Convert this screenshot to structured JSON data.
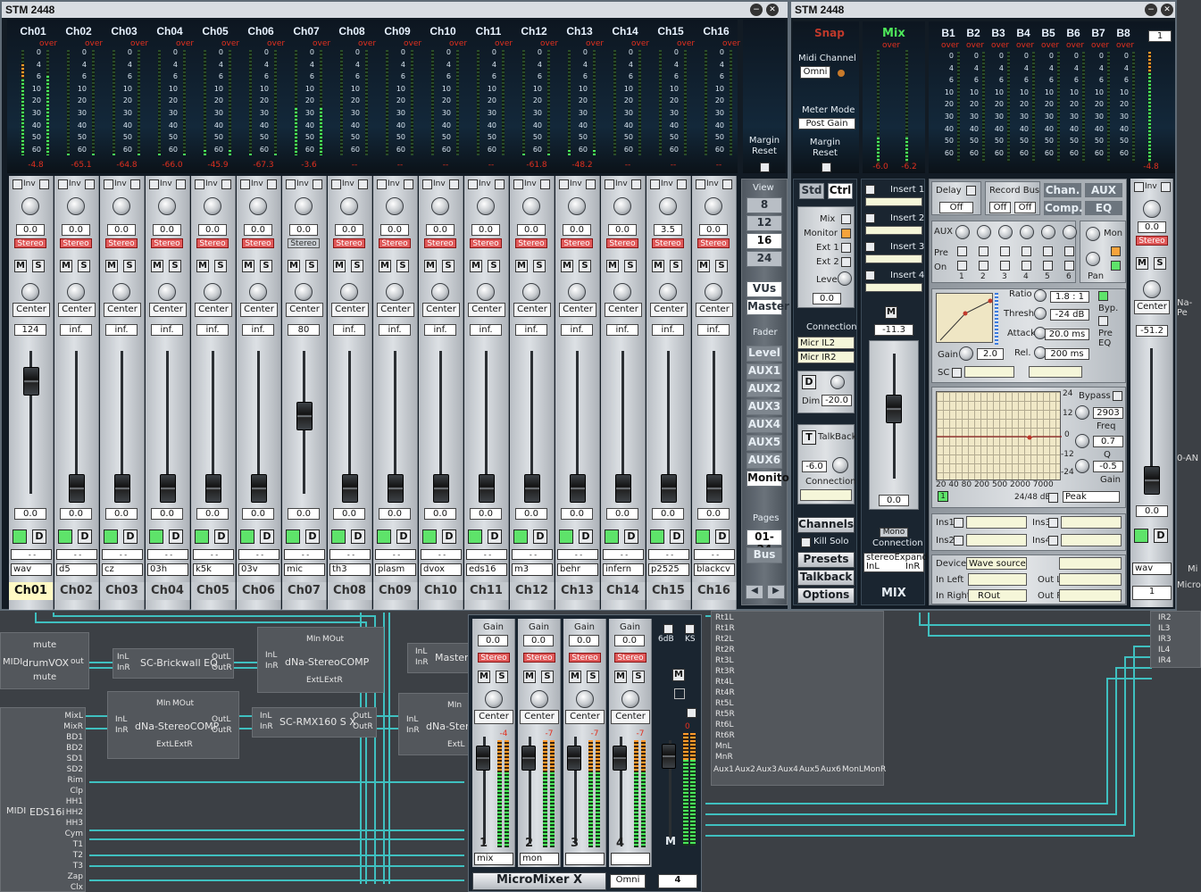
{
  "main_window": {
    "title": "STM 2448",
    "minimize": "−",
    "close": "✕"
  },
  "ctrl_window": {
    "title": "STM 2448",
    "minimize": "−",
    "close": "✕"
  },
  "meter_scale": [
    "0",
    "4",
    "6",
    "10",
    "20",
    "30",
    "40",
    "50",
    "60"
  ],
  "over_label": "over",
  "margin_reset": "Margin Reset",
  "channels": [
    {
      "name": "Ch01",
      "peak": "-4.8",
      "gain": "0.0",
      "stereo": "Stereo",
      "pan": "Center",
      "level": "124",
      "fader": "0.0",
      "label": "wav",
      "tab": "Ch01",
      "lvl": 0.75,
      "fpos": 0.88
    },
    {
      "name": "Ch02",
      "peak": "-65.1",
      "gain": "0.0",
      "stereo": "Stereo",
      "pan": "Center",
      "level": "inf.",
      "fader": "0.0",
      "label": "d5",
      "tab": "Ch02",
      "lvl": 0.02,
      "fpos": 0.08
    },
    {
      "name": "Ch03",
      "peak": "-64.8",
      "gain": "0.0",
      "stereo": "Stereo",
      "pan": "Center",
      "level": "inf.",
      "fader": "0.0",
      "label": "cz",
      "tab": "Ch03",
      "lvl": 0.02,
      "fpos": 0.08
    },
    {
      "name": "Ch04",
      "peak": "-66.0",
      "gain": "0.0",
      "stereo": "Stereo",
      "pan": "Center",
      "level": "inf.",
      "fader": "0.0",
      "label": "03h",
      "tab": "Ch04",
      "lvl": 0.02,
      "fpos": 0.08
    },
    {
      "name": "Ch05",
      "peak": "-45.9",
      "gain": "0.0",
      "stereo": "Stereo",
      "pan": "Center",
      "level": "inf.",
      "fader": "0.0",
      "label": "k5k",
      "tab": "Ch05",
      "lvl": 0.05,
      "fpos": 0.08
    },
    {
      "name": "Ch06",
      "peak": "-67.3",
      "gain": "0.0",
      "stereo": "Stereo",
      "pan": "Center",
      "level": "inf.",
      "fader": "0.0",
      "label": "03v",
      "tab": "Ch06",
      "lvl": 0.02,
      "fpos": 0.08
    },
    {
      "name": "Ch07",
      "peak": "-3.6",
      "gain": "0.0",
      "stereo": "Stereo",
      "pan": "Center",
      "level": "80",
      "fader": "0.0",
      "label": "mic",
      "tab": "Ch07",
      "lvl": 0.45,
      "fpos": 0.62,
      "mono": true
    },
    {
      "name": "Ch08",
      "peak": "--",
      "gain": "0.0",
      "stereo": "Stereo",
      "pan": "Center",
      "level": "inf.",
      "fader": "0.0",
      "label": "th3",
      "tab": "Ch08",
      "lvl": 0,
      "fpos": 0.08
    },
    {
      "name": "Ch09",
      "peak": "--",
      "gain": "0.0",
      "stereo": "Stereo",
      "pan": "Center",
      "level": "inf.",
      "fader": "0.0",
      "label": "plasm",
      "tab": "Ch09",
      "lvl": 0,
      "fpos": 0.08
    },
    {
      "name": "Ch10",
      "peak": "--",
      "gain": "0.0",
      "stereo": "Stereo",
      "pan": "Center",
      "level": "inf.",
      "fader": "0.0",
      "label": "dvox",
      "tab": "Ch10",
      "lvl": 0,
      "fpos": 0.08
    },
    {
      "name": "Ch11",
      "peak": "--",
      "gain": "0.0",
      "stereo": "Stereo",
      "pan": "Center",
      "level": "inf.",
      "fader": "0.0",
      "label": "eds16",
      "tab": "Ch11",
      "lvl": 0,
      "fpos": 0.08
    },
    {
      "name": "Ch12",
      "peak": "-61.8",
      "gain": "0.0",
      "stereo": "Stereo",
      "pan": "Center",
      "level": "inf.",
      "fader": "0.0",
      "label": "m3",
      "tab": "Ch12",
      "lvl": 0.02,
      "fpos": 0.08
    },
    {
      "name": "Ch13",
      "peak": "-48.2",
      "gain": "0.0",
      "stereo": "Stereo",
      "pan": "Center",
      "level": "inf.",
      "fader": "0.0",
      "label": "behr",
      "tab": "Ch13",
      "lvl": 0.05,
      "fpos": 0.08
    },
    {
      "name": "Ch14",
      "peak": "--",
      "gain": "0.0",
      "stereo": "Stereo",
      "pan": "Center",
      "level": "inf.",
      "fader": "0.0",
      "label": "infern",
      "tab": "Ch14",
      "lvl": 0,
      "fpos": 0.08
    },
    {
      "name": "Ch15",
      "peak": "--",
      "gain": "3.5",
      "stereo": "Stereo",
      "pan": "Center",
      "level": "inf.",
      "fader": "0.0",
      "label": "p2525",
      "tab": "Ch15",
      "lvl": 0,
      "fpos": 0.08
    },
    {
      "name": "Ch16",
      "peak": "--",
      "gain": "0.0",
      "stereo": "Stereo",
      "pan": "Center",
      "level": "inf.",
      "fader": "0.0",
      "label": "blackcv",
      "tab": "Ch16",
      "lvl": 0,
      "fpos": 0.08
    }
  ],
  "strip": {
    "inv": "Inv",
    "mute": "M",
    "solo": "S",
    "d": "D",
    "slot": "- -"
  },
  "nav": {
    "view_label": "View",
    "view_options": [
      "8",
      "12",
      "16",
      "24"
    ],
    "view_selected": "16",
    "vus": "VUs",
    "master": "Master",
    "fader_label": "Fader",
    "fader_options": [
      "Level",
      "AUX1",
      "AUX2",
      "AUX3",
      "AUX4",
      "AUX5",
      "AUX6",
      "Monitor"
    ],
    "fader_selected": "Monitor",
    "pages_label": "Pages",
    "pages_value": "01-24",
    "bus": "Bus",
    "prev": "◀",
    "next": "▶"
  },
  "ctrl": {
    "snap": "Snap",
    "midi_channel_label": "Midi Channel",
    "midi_channel_value": "Omni",
    "meter_mode_label": "Meter Mode",
    "meter_mode_value": "Post Gain",
    "margin_reset": "Margin Reset",
    "mix_title": "Mix",
    "mix_peak_l": "-6.0",
    "mix_peak_r": "-6.2",
    "bus_names": [
      "B1",
      "B2",
      "B3",
      "B4",
      "B5",
      "B6",
      "B7",
      "B8"
    ],
    "bus_page": "1",
    "bus_peak": "-4.8",
    "std": "Std",
    "ctrl": "Ctrl",
    "monitor_items": [
      "Mix",
      "Monitor",
      "Ext 1",
      "Ext 2"
    ],
    "level_label": "Level",
    "level_value": "0.0",
    "connection_label": "Connection",
    "connection_values": [
      "Micr IL2",
      "Micr IR2"
    ],
    "dim_label": "Dim",
    "dim_value": "-20.0",
    "talkback_label": "TalkBack",
    "talkback_value": "-6.0",
    "talkback_conn": "Connection",
    "channels_btn": "Channels",
    "kill_solo": "Kill Solo",
    "presets_btn": "Presets",
    "talkback_btn": "Talkback",
    "options_btn": "Options",
    "inserts": [
      "Insert 1",
      "Insert 2",
      "Insert 3",
      "Insert 4"
    ],
    "mix_m": "M",
    "mix_level": "-11.3",
    "mix_fader_value": "0.0",
    "mono": "Mono",
    "mix_connection": "Connection",
    "mix_conn_value": "stereoExpander",
    "mix_inl": "InL",
    "mix_inr": "InR",
    "mix_label": "MIX",
    "delay": "Delay",
    "delay_value": "Off",
    "record_bus": "Record Bus",
    "rb_off1": "Off",
    "rb_off2": "Off",
    "chan_btn": "Chan.",
    "aux_btn": "AUX",
    "comp_btn": "Comp.",
    "eq_btn": "EQ",
    "aux_label": "AUX",
    "mon_label": "Mon",
    "pre_label": "Pre",
    "on_label": "On",
    "pan_label": "Pan",
    "aux_numbers": [
      "1",
      "2",
      "3",
      "4",
      "5",
      "6"
    ],
    "ratio_label": "Ratio",
    "ratio_value": "1.8 : 1",
    "thresh_label": "Thresh.",
    "thresh_value": "-24 dB",
    "attack_label": "Attack",
    "attack_value": "20.0 ms",
    "rel_label": "Rel.",
    "rel_value": "200 ms",
    "gain_label": "Gain",
    "gain_value": "2.0",
    "sc_label": "SC",
    "byp_label": "Byp.",
    "pre_eq_label": "Pre EQ",
    "eq_top": "24",
    "eq_mid1": "12",
    "eq_zero": "0",
    "eq_m12": "-12",
    "eq_m24": "-24",
    "eq_freqs": "20  40  80  200 500   2000  7000",
    "eq_db": "24/48 dB",
    "eq_peak": "Peak",
    "eq_chk": "1",
    "bypass": "Bypass",
    "freq_value": "2903",
    "freq_label": "Freq",
    "q_value": "0.7",
    "q_label": "Q",
    "eqgain_value": "-0.5",
    "eqgain_label": "Gain",
    "ins_labels": [
      "Ins1",
      "Ins2",
      "Ins3",
      "Ins4"
    ],
    "device_label": "Device",
    "device_value": "Wave source",
    "in_left_label": "In Left",
    "in_right_label": "In Right",
    "in_right_value": "ROut",
    "out_l_label": "Out L",
    "out_r_label": "Out R",
    "master_strip": {
      "gain": "0.0",
      "stereo": "Stereo",
      "pan": "Center",
      "level": "-51.2",
      "fader": "0.0",
      "label": "wav",
      "page": "1"
    }
  },
  "micromixer": {
    "title": "MicroMixer X",
    "midi": "Omni",
    "gain_label": "Gain",
    "channels": [
      {
        "num": "1",
        "gain": "0.0",
        "stereo": "Stereo",
        "pan": "Center",
        "top": "-4",
        "label": "mix"
      },
      {
        "num": "2",
        "gain": "0.0",
        "stereo": "Stereo",
        "pan": "Center",
        "top": "-7",
        "label": "mon"
      },
      {
        "num": "3",
        "gain": "0.0",
        "stereo": "Stereo",
        "pan": "Center",
        "top": "-7",
        "label": ""
      },
      {
        "num": "4",
        "gain": "0.0",
        "stereo": "Stereo",
        "pan": "Center",
        "top": "-7",
        "label": ""
      }
    ],
    "six_db": "6dB",
    "ks": "KS",
    "m": "M",
    "master_top": "0",
    "count": "4"
  },
  "routing": {
    "drumvox": {
      "title": "drumVOX",
      "midi": "MIDI",
      "out": "out",
      "mute1": "mute",
      "mute2": "mute"
    },
    "brickwall": {
      "title": "SC-Brickwall EQ",
      "inl": "InL",
      "inr": "InR",
      "outl": "OutL",
      "outr": "OutR"
    },
    "comp1": {
      "title": "dNa-StereoCOMP",
      "min": "MIn",
      "mout": "MOut",
      "inl": "InL",
      "inr": "InR",
      "outl": "OutL",
      "outr": "OutR",
      "extl": "ExtL",
      "extr": "ExtR"
    },
    "master": {
      "title": "Master",
      "inl": "InL",
      "inr": "InR"
    },
    "comp2": {
      "title": "dNa-StereoCOMP",
      "min": "MIn",
      "mout": "MOut",
      "inl": "InL",
      "inr": "InR",
      "outl": "OutL",
      "outr": "OutR",
      "extl": "ExtL",
      "extr": "ExtR"
    },
    "rmx": {
      "title": "SC-RMX160 S X",
      "inl": "InL",
      "inr": "InR",
      "outl": "OutL",
      "outr": "OutR"
    },
    "comp3": {
      "title": "dNa-Stere",
      "min": "MIn",
      "inl": "InL",
      "inr": "InR",
      "extl": "ExtL"
    },
    "eds16i": {
      "title": "EDS16i",
      "midi": "MIDI",
      "ports": [
        "MixL",
        "MixR",
        "BD1",
        "BD2",
        "SD1",
        "SD2",
        "Rim",
        "Clp",
        "HH1",
        "HH2",
        "HH3",
        "Cym",
        "T1",
        "T2",
        "T3",
        "Zap",
        "Clx"
      ]
    },
    "returns": {
      "ports": [
        "Rt1L",
        "Rt1R",
        "Rt2L",
        "Rt2R",
        "Rt3L",
        "Rt3R",
        "Rt4L",
        "Rt4R",
        "Rt5L",
        "Rt5R",
        "Rt6L",
        "Rt6R",
        "MnL",
        "MnR"
      ],
      "bottom": [
        "Aux1",
        "Aux2",
        "Aux3",
        "Aux4",
        "Aux5",
        "Aux6",
        "MonL",
        "MonR"
      ]
    },
    "inputs": {
      "ports": [
        "IR2",
        "IL3",
        "IR3",
        "IL4",
        "IR4"
      ]
    },
    "right_labels": [
      "Na-Pe",
      "0-AN",
      "Mi",
      "Micro"
    ]
  }
}
